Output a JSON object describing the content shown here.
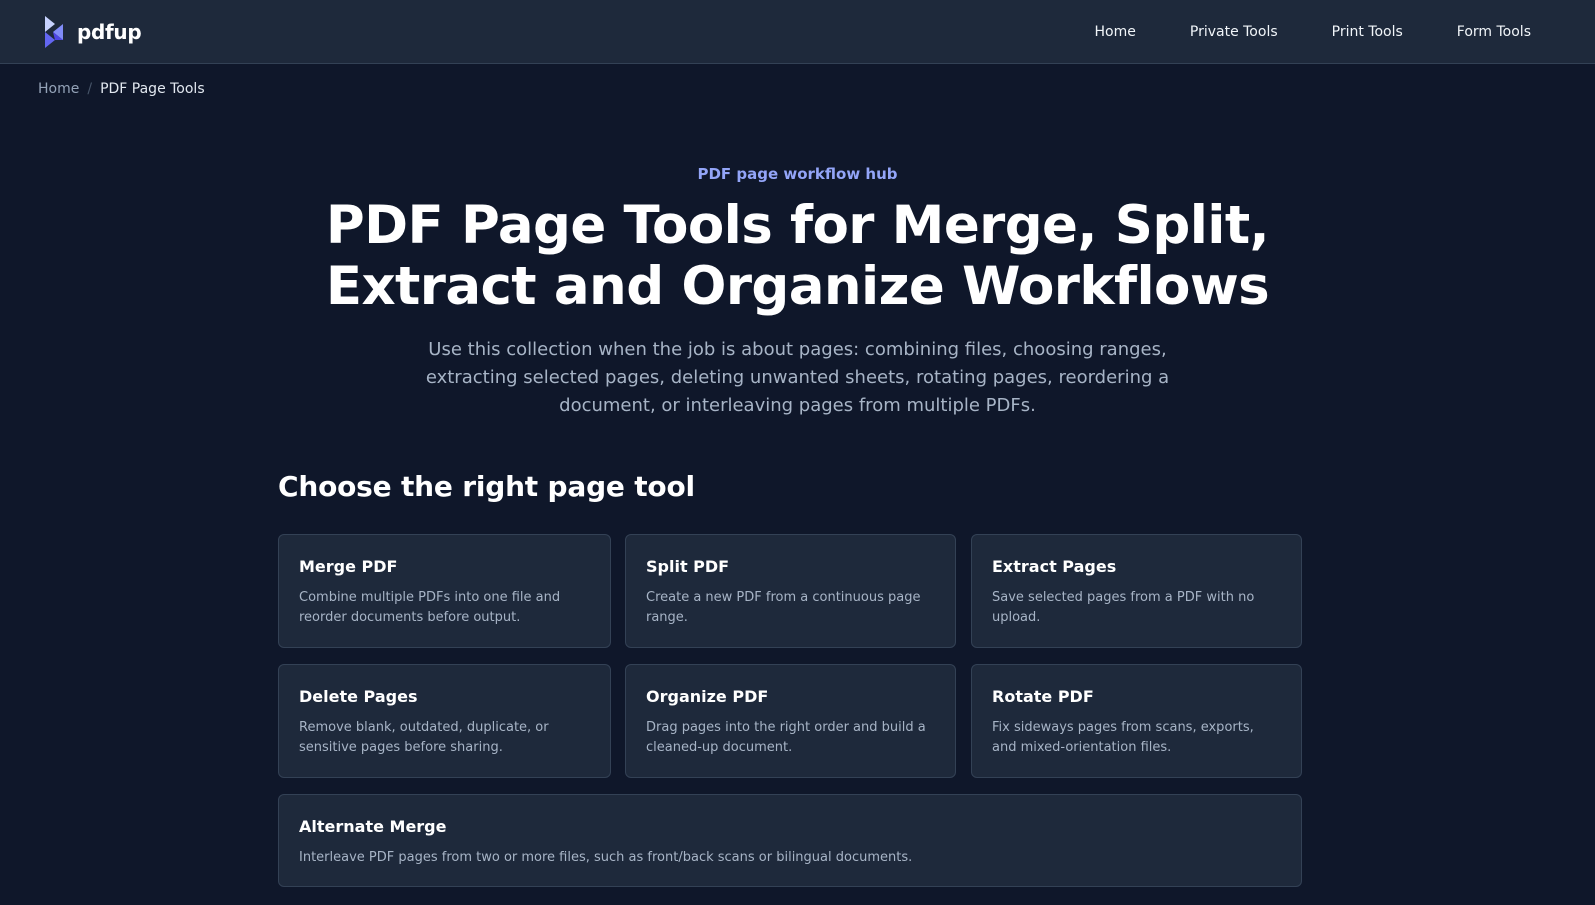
{
  "header": {
    "logo_icon": "pdfup-logo-icon",
    "brand": "pdfup",
    "nav": [
      "Home",
      "Private Tools",
      "Print Tools",
      "Form Tools"
    ]
  },
  "breadcrumb": {
    "home": "Home",
    "separator": "/",
    "current": "PDF Page Tools"
  },
  "hero": {
    "eyebrow": "PDF page workflow hub",
    "title_line1": "PDF Page Tools for Merge, Split,",
    "title_line2": "Extract and Organize Workflows",
    "lead": "Use this collection when the job is about pages: combining files, choosing ranges, extracting selected pages, deleting unwanted sheets, rotating pages, reordering a document, or interleaving pages from multiple PDFs."
  },
  "section": {
    "title": "Choose the right page tool"
  },
  "tools": [
    {
      "title": "Merge PDF",
      "desc": "Combine multiple PDFs into one file and reorder documents before output."
    },
    {
      "title": "Split PDF",
      "desc": "Create a new PDF from a continuous page range."
    },
    {
      "title": "Extract Pages",
      "desc": "Save selected pages from a PDF with no upload."
    },
    {
      "title": "Delete Pages",
      "desc": "Remove blank, outdated, duplicate, or sensitive pages before sharing."
    },
    {
      "title": "Organize PDF",
      "desc": "Drag pages into the right order and build a cleaned-up document."
    },
    {
      "title": "Rotate PDF",
      "desc": "Fix sideways pages from scans, exports, and mixed-orientation files."
    },
    {
      "title": "Alternate Merge",
      "desc": "Interleave PDF pages from two or more files, such as front/back scans or bilingual documents."
    }
  ],
  "colors": {
    "background": "#0f172a",
    "surface": "#1e293b",
    "border": "#334155",
    "accent": "#93a5f8",
    "logo_primary": "#6366f1",
    "logo_light": "#c7d2fe"
  }
}
